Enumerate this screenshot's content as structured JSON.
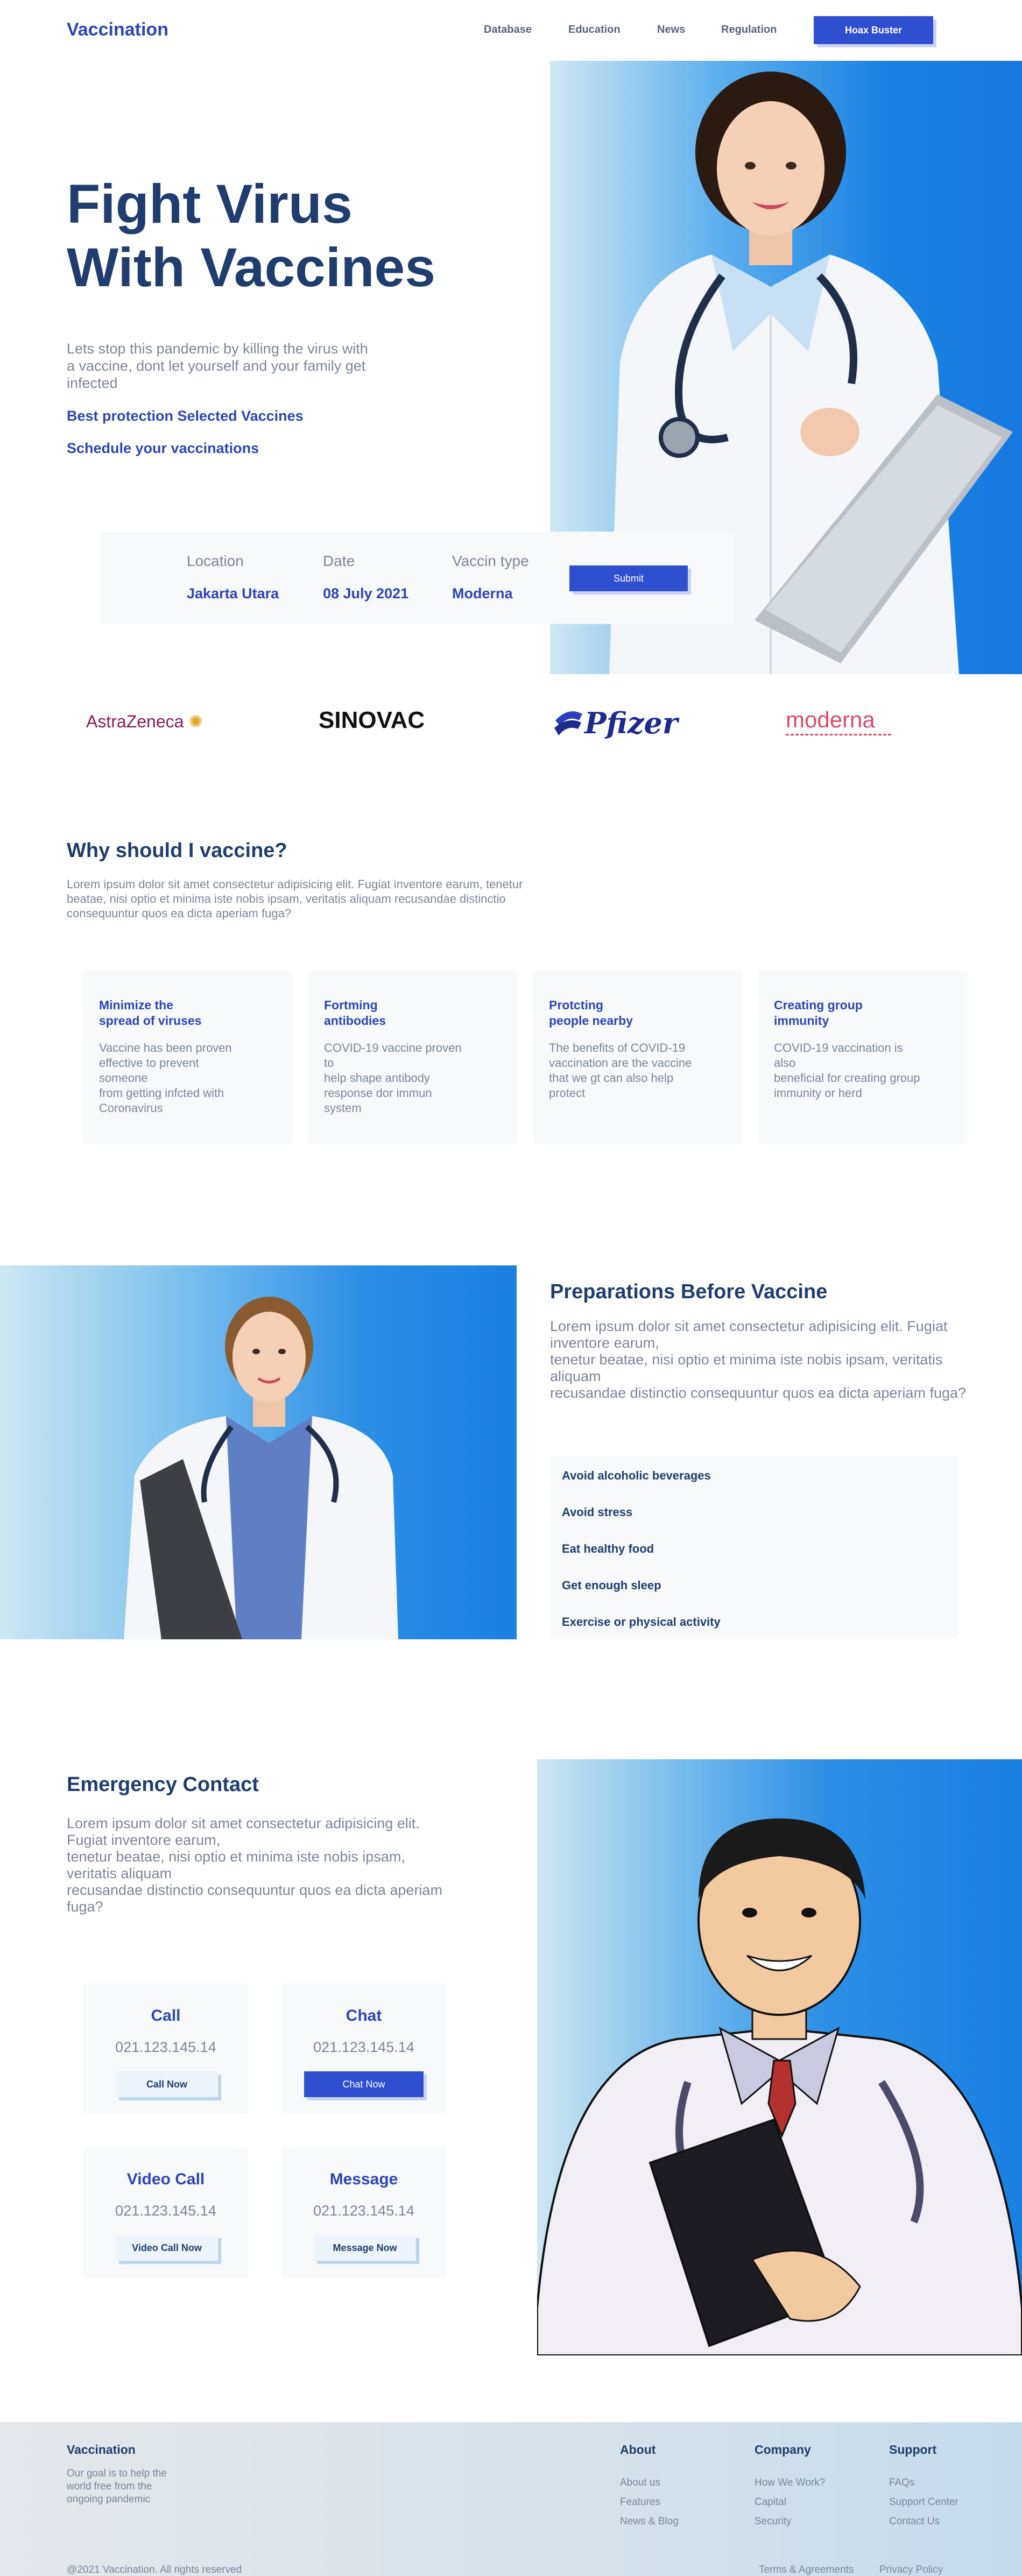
{
  "nav": {
    "logo": "Vaccination",
    "links": [
      "Database",
      "Education",
      "News",
      "Regulation"
    ],
    "cta": "Hoax Buster"
  },
  "hero": {
    "title_line1": "Fight Virus",
    "title_line2": "With Vaccines",
    "description": "Lets stop this pandemic by killing the virus with a vaccine, dont let yourself and your family get infected",
    "link1": "Best protection Selected Vaccines",
    "link2": "Schedule your vaccinations"
  },
  "booking": {
    "location_label": "Location",
    "location_value": "Jakarta Utara",
    "date_label": "Date",
    "date_value": "08 July 2021",
    "type_label": "Vaccin type",
    "type_value": "Moderna",
    "submit": "Submit"
  },
  "brands": [
    "AstraZeneca",
    "SINOVAC",
    "Pfizer",
    "moderna"
  ],
  "why": {
    "title": "Why should I vaccine?",
    "description": "Lorem ipsum dolor sit amet consectetur adipisicing elit. Fugiat inventore earum, tenetur beatae, nisi optio et minima iste nobis ipsam, veritatis aliquam recusandae distinctio consequuntur quos ea dicta aperiam fuga?",
    "cards": [
      {
        "title": "Minimize the\nspread of viruses",
        "text": "Vaccine has been proven\neffective to prevent\nsomeone\nfrom getting infcted with\nCoronavirus"
      },
      {
        "title": "Fortming\nantibodies",
        "text": "COVID-19 vaccine proven\nto\nhelp shape antibody\nresponse dor immun\nsystem"
      },
      {
        "title": "Protcting\npeople nearby",
        "text": "The benefits of COVID-19\nvaccination are the vaccine\nthat we gt can also help\nprotect"
      },
      {
        "title": "Creating group\nimmunity",
        "text": "COVID-19 vaccination is\nalso\nbeneficial for creating group\nimmunity or herd"
      }
    ]
  },
  "prep": {
    "title": "Preparations Before Vaccine",
    "description": "Lorem ipsum dolor sit amet consectetur adipisicing elit. Fugiat inventore earum,\ntenetur beatae, nisi optio et minima iste nobis ipsam, veritatis aliquam\nrecusandae distinctio consequuntur quos ea dicta aperiam fuga?",
    "items": [
      "Avoid alcoholic beverages",
      "Avoid stress",
      "Eat healthy food",
      "Get enough sleep",
      "Exercise or physical activity"
    ]
  },
  "emergency": {
    "title": "Emergency Contact",
    "description": "Lorem ipsum dolor sit amet consectetur adipisicing elit.\nFugiat inventore earum,\ntenetur beatae, nisi optio et minima iste nobis ipsam,\nveritatis aliquam\nrecusandae distinctio consequuntur quos ea dicta aperiam\nfuga?",
    "contacts": [
      {
        "title": "Call",
        "number": "021.123.145.14",
        "button": "Call Now"
      },
      {
        "title": "Chat",
        "number": "021.123.145.14",
        "button": "Chat Now"
      },
      {
        "title": "Video Call",
        "number": "021.123.145.14",
        "button": "Video Call Now"
      },
      {
        "title": "Message",
        "number": "021.123.145.14",
        "button": "Message Now"
      }
    ]
  },
  "footer": {
    "brand": "Vaccination",
    "description": "Our goal is to help the\nworld free from the\nongoing pandemic",
    "columns": [
      {
        "head": "About",
        "links": [
          "About us",
          "Features",
          "News & Blog"
        ]
      },
      {
        "head": "Company",
        "links": [
          "How We Work?",
          "Capital",
          "Security"
        ]
      },
      {
        "head": "Support",
        "links": [
          "FAQs",
          "Support Center",
          "Contact Us"
        ]
      }
    ],
    "copyright": "@2021 Vaccination. All rights reserved",
    "legal": [
      "Terms & Agreements",
      "Privacy Policy"
    ]
  },
  "colors": {
    "primary": "#2f4fd1",
    "navy": "#1f3d6e",
    "text_grey": "#7c8597",
    "hero_blue": "#1678e0"
  }
}
